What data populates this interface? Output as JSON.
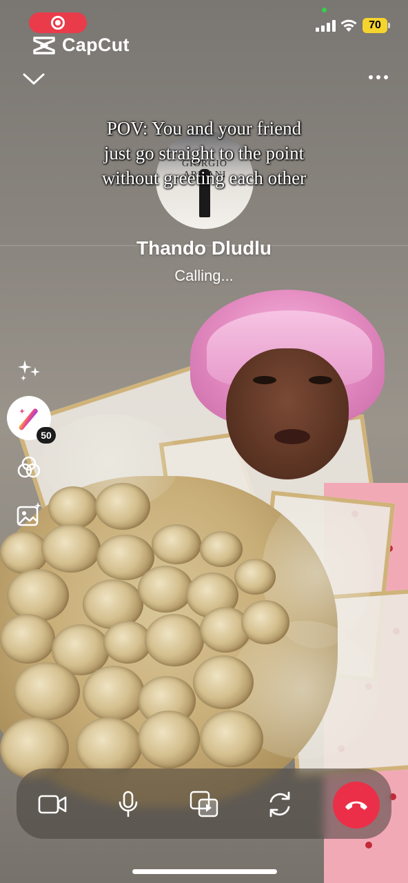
{
  "status_bar": {
    "battery_level": "70",
    "recording_indicator_color": "#ea3b4b",
    "battery_color": "#f5d42d"
  },
  "branding": {
    "app_name": "CapCut"
  },
  "overlay_caption": {
    "line1": "POV: You and your friend",
    "line2": "just go straight to the point",
    "line3": "without greeting each other"
  },
  "avatar_logo_text": "GIORGIO ARMANI",
  "call": {
    "contact_name": "Thando Dludlu",
    "status": "Calling..."
  },
  "effects_panel": {
    "icons": [
      "sparkles-icon",
      "magic-wand-icon",
      "filters-icon",
      "photo-sparkle-icon"
    ],
    "magic_badge_count": "50"
  },
  "controls": {
    "icons": [
      "video-camera-icon",
      "microphone-icon",
      "share-screen-icon",
      "flip-camera-icon",
      "end-call-icon"
    ],
    "end_call_color": "#eb2f48"
  }
}
